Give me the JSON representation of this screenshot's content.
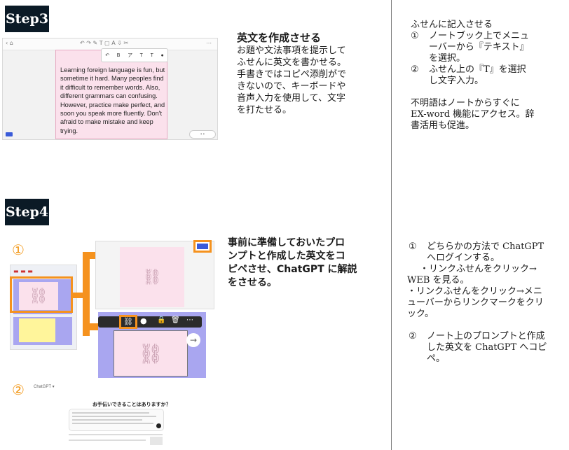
{
  "step3": {
    "badge": "Step3",
    "title": "英文を作成させる",
    "body_lines": [
      "お題や文法事項を提示して",
      "ふせんに英文を書かせる。",
      "手書きではコピペ添削がで",
      "きないので、キーボードや",
      "音声入力を使用して、文字",
      "を打たせる。"
    ],
    "note_heading": "ふせんに記入させる",
    "steps": [
      {
        "num": "①",
        "lines": [
          "ノートブック上でメニュ",
          "ーバーから『テキスト』",
          "を選択。"
        ]
      },
      {
        "num": "②",
        "lines": [
          "ふせん上の『T』を選択",
          "し文字入力。"
        ]
      }
    ],
    "extra_lines": [
      "不明語はノートからすぐに",
      "EX-word 機能にアクセス。辞",
      "書活用も促進。"
    ],
    "screenshot": {
      "note_text": "Learning foreign language is fun, but sometime it hard. Many peoples find it difficult to remember words. Also, different grammars can confusing. However, practice make perfect, and soon you speak more fluently. Don't afraid to make mistake and keep trying.",
      "toolbar_items": [
        "↶",
        "B",
        "ア",
        "T",
        "T",
        "●"
      ]
    }
  },
  "step4": {
    "badge": "Step4",
    "title_lines": [
      "事前に準備しておいたプロ",
      "ンプトと作成した英文をコ",
      "ピペさせ、ChatGPT に解説",
      "をさせる。"
    ],
    "marker1": "①",
    "marker2": "②",
    "steps": [
      {
        "num": "①",
        "lines": [
          "どちらかの方法で ChatGPT",
          "へログインする。"
        ]
      }
    ],
    "bullets": [
      [
        "・リンクふせんをクリック→",
        "WEB を見る。"
      ],
      [
        "・リンクふせんをクリック→メニ",
        "ューバーからリンクマークをクリ",
        "ック。"
      ]
    ],
    "steps2": [
      {
        "num": "②",
        "lines": [
          "ノート上のプロンプトと作成",
          "した英文を ChatGPT へコピ",
          "ペ。"
        ]
      }
    ],
    "chatgpt_heading": "お手伝いできることはありますか？",
    "chatgpt_label": "ChatGPT ▾"
  },
  "colors": {
    "badge_bg": "#0b1a26",
    "accent_orange": "#f5921e",
    "note_pink": "#fbe1ec",
    "panel_blue": "#a9a6f0"
  }
}
